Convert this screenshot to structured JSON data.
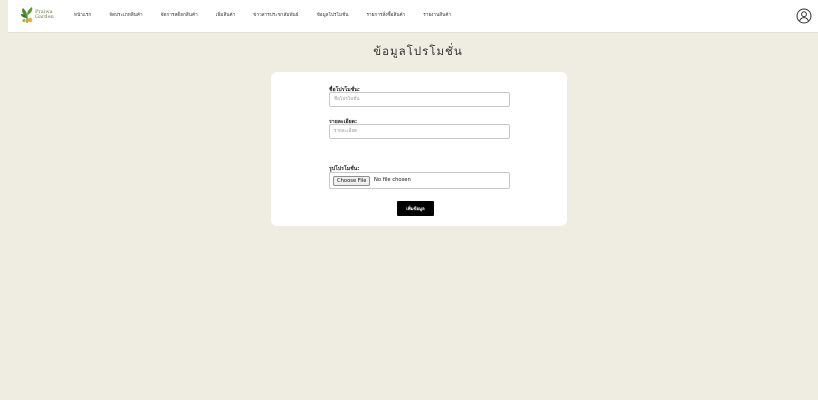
{
  "brand": {
    "logo_line1": "Praiwa",
    "logo_line2": "Garden",
    "colors": {
      "leaf": "#4f8a2e",
      "flower": "#e6b422",
      "text": "#6b7a52"
    }
  },
  "nav": {
    "items": [
      {
        "label": "หน้าแรก"
      },
      {
        "label": "จัดประเภทสินค้า"
      },
      {
        "label": "จัดการสต็อกสินค้า"
      },
      {
        "label": "เพิ่มสินค้า"
      },
      {
        "label": "ข่าวสารประชาสัมพันธ์"
      },
      {
        "label": "ข้อมูลโปรโมชั่น"
      },
      {
        "label": "รายการสั่งซื้อสินค้า"
      },
      {
        "label": "รายงานสินค้า"
      }
    ],
    "user_icon": "user-circle-icon"
  },
  "page": {
    "title": "ข้อมูลโปรโมชั่น",
    "background": "#efede1"
  },
  "form": {
    "name_label": "ชื่อโปรโมชั่น:",
    "name_placeholder": "ชื่อโปรโมชั่น",
    "detail_label": "รายละเอียด:",
    "detail_placeholder": "รายละเอียด",
    "image_label": "รูปโปรโมชั่น:",
    "file_button": "Choose File",
    "file_status": "No file chosen",
    "submit_label": "เพิ่มข้อมูล"
  }
}
